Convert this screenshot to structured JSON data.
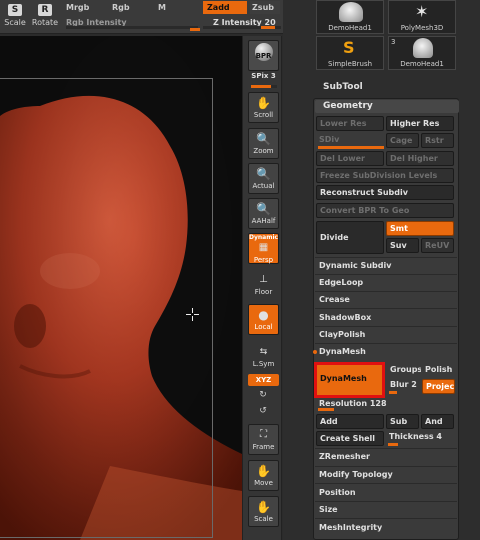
{
  "toolbar": {
    "scale_label": "Scale",
    "rotate_label": "Rotate",
    "mrgb_label": "Mrgb",
    "rgb_label": "Rgb",
    "m_label": "M",
    "zadd_label": "Zadd",
    "zsub_label": "Zsub",
    "rgb_intensity_label": "Rgb Intensity",
    "z_intensity_label": "Z Intensity 20",
    "z_intensity_value": 20,
    "accent_color": "#e9690e"
  },
  "shelf": {
    "bpr_label": "BPR",
    "spix_label": "SPix 3",
    "scroll_label": "Scroll",
    "zoom_label": "Zoom",
    "actual_label": "Actual",
    "aahalf_label": "AAHalf",
    "dynamic_label": "Dynamic",
    "persp_label": "Persp",
    "floor_label": "Floor",
    "local_label": "Local",
    "lsym_label": "L.Sym",
    "xyz_label": "XYZ",
    "frame_label": "Frame",
    "move_label": "Move",
    "scale_label": "Scale"
  },
  "tool_thumbs": [
    {
      "label": "DemoHead1",
      "badge": ""
    },
    {
      "label": "PolyMesh3D",
      "badge": ""
    },
    {
      "label": "SimpleBrush",
      "badge": ""
    },
    {
      "label": "DemoHead1",
      "badge": "3"
    }
  ],
  "subtool_label": "SubTool",
  "geometry": {
    "title": "Geometry",
    "lower_res": "Lower Res",
    "higher_res": "Higher Res",
    "sdiv": "SDiv",
    "cage": "Cage",
    "rstr": "Rstr",
    "del_lower": "Del Lower",
    "del_higher": "Del Higher",
    "freeze_subdivision": "Freeze SubDivision Levels",
    "reconstruct_subdiv": "Reconstruct Subdiv",
    "convert_bpr": "Convert BPR To Geo",
    "divide": "Divide",
    "smt": "Smt",
    "suv": "Suv",
    "reuv": "ReUV",
    "dynamic_subdiv": "Dynamic Subdiv",
    "edgeloop": "EdgeLoop",
    "crease": "Crease",
    "shadowbox": "ShadowBox",
    "claypolish": "ClayPolish",
    "dynamesh_header": "DynaMesh",
    "dynamesh_button": "DynaMesh",
    "groups": "Groups",
    "polish": "Polish",
    "blur": "Blur 2",
    "project": "Projec",
    "resolution": "Resolution 128",
    "add": "Add",
    "sub": "Sub",
    "and": "And",
    "create_shell": "Create Shell",
    "thickness": "Thickness 4",
    "zremesher": "ZRemesher",
    "modify_topology": "Modify Topology",
    "position": "Position",
    "size": "Size",
    "meshintegrity": "MeshIntegrity"
  }
}
